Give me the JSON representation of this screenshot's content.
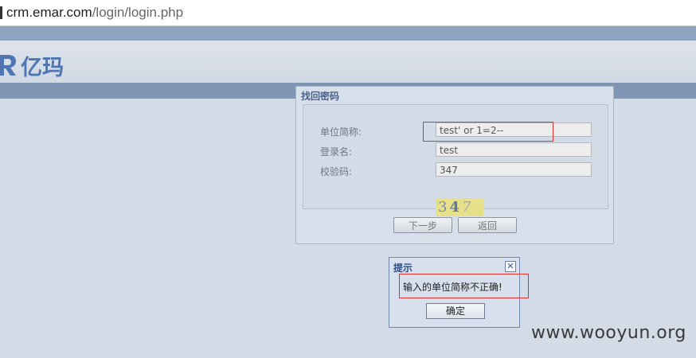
{
  "browser": {
    "url_host": "crm.emar.com",
    "url_path": "/login/login.php"
  },
  "header": {
    "logo_text": "亿玛",
    "logo_mark_icon": "emar-logo-mark",
    "logo_color": "#4f76b2"
  },
  "recover_panel": {
    "title": "找回密码",
    "fields": [
      {
        "label": "单位简称:",
        "value": "test' or 1=2--"
      },
      {
        "label": "登录名:",
        "value": "test"
      },
      {
        "label": "校验码:",
        "value": "347"
      }
    ],
    "captcha": {
      "d1": "3",
      "d2": "4",
      "d3": "7"
    },
    "next_label": "下一步",
    "back_label": "返回"
  },
  "dialog": {
    "title": "提示",
    "close_icon": "close-x-icon",
    "message": "输入的单位简称不正确!",
    "ok_label": "确定"
  },
  "watermark": "www.wooyun.org",
  "colors": {
    "annotation_red": "#e03030",
    "page_bg": "#d3dbe7",
    "header_band": "#7e95b4"
  }
}
